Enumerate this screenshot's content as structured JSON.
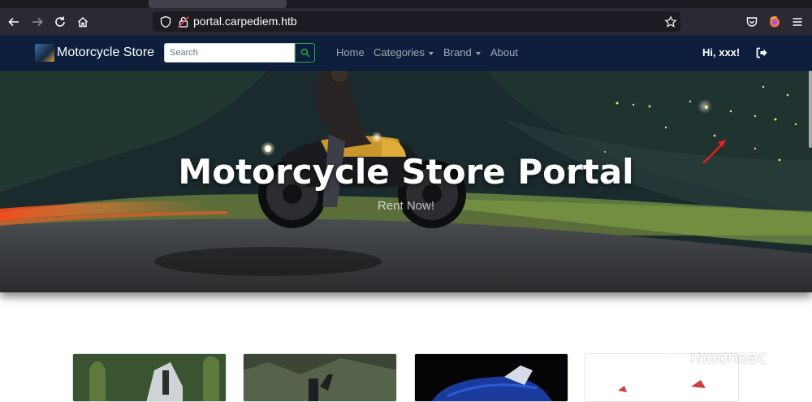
{
  "browser": {
    "url": "portal.carpediem.htb"
  },
  "navbar": {
    "brand": "Motorcycle Store",
    "search_placeholder": "Search",
    "links": [
      {
        "label": "Home"
      },
      {
        "label": "Categories"
      },
      {
        "label": "Brand"
      },
      {
        "label": "About"
      }
    ],
    "greeting": "Hi, xxx!"
  },
  "hero": {
    "title": "Motorcycle Store Portal",
    "subtitle": "Rent Now!"
  },
  "watermark": "moonsec",
  "colors": {
    "navbar_bg": "#0d1f3c",
    "search_button": "#28a745",
    "annotation_arrow": "#e5201e"
  }
}
